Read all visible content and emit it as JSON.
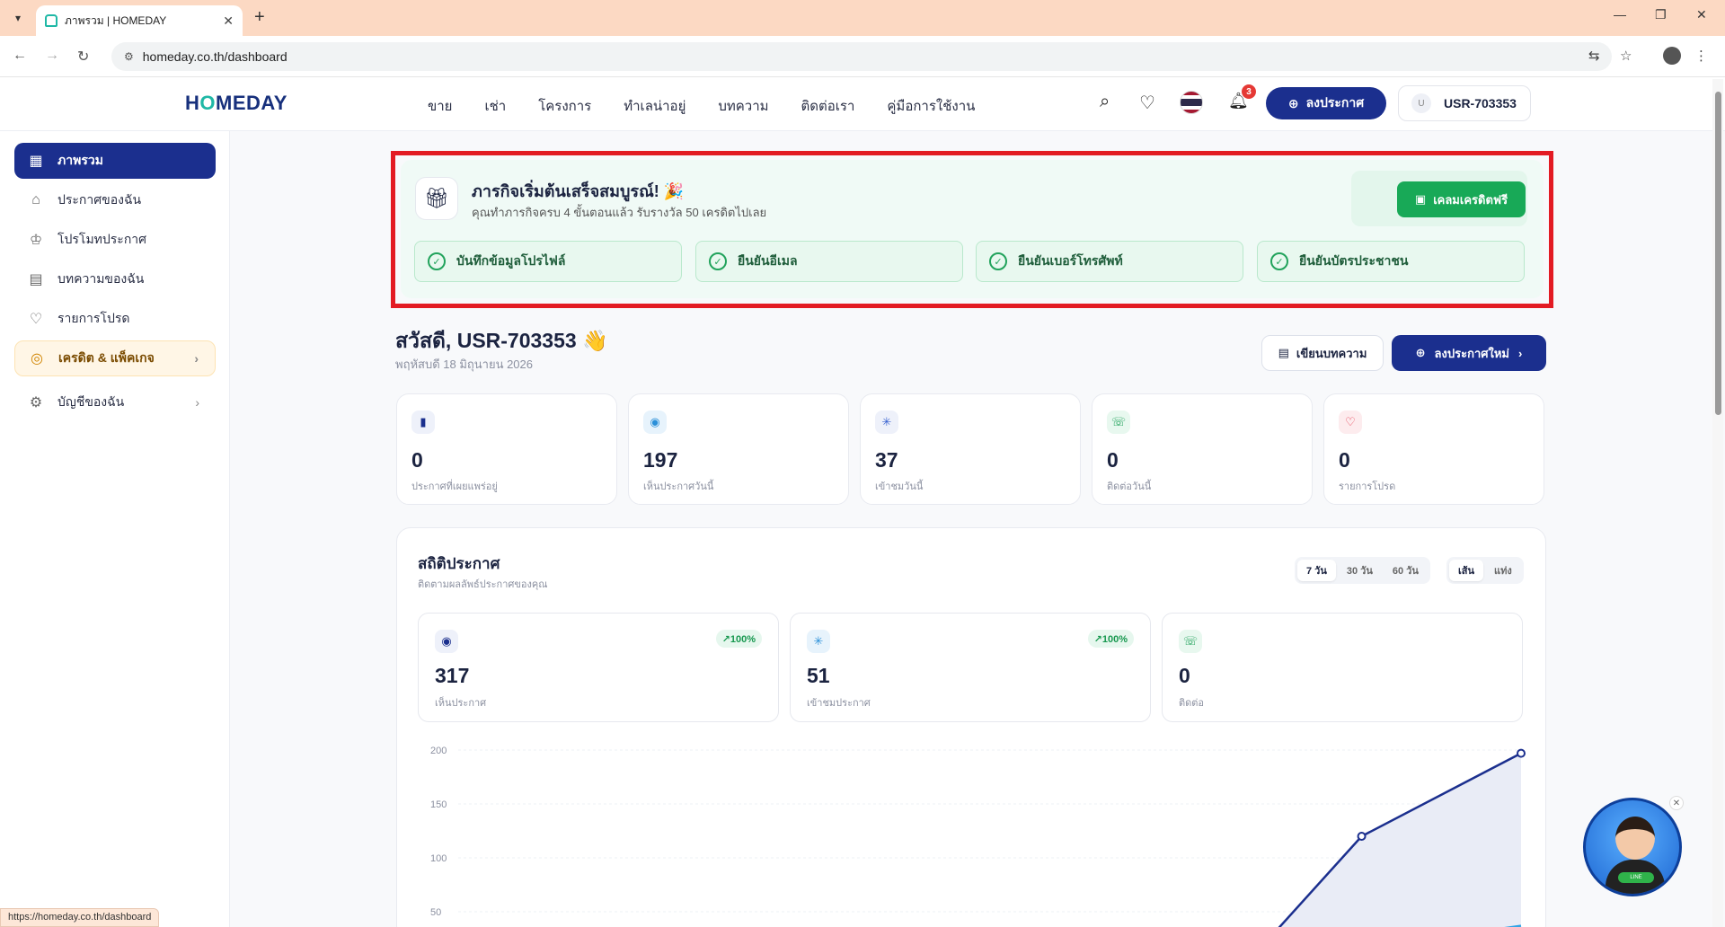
{
  "browser": {
    "tab_title": "ภาพรวม | HOMEDAY",
    "url": "homeday.co.th/dashboard",
    "status_url": "https://homeday.co.th/dashboard"
  },
  "header": {
    "logo_pre": "H",
    "logo_o": "O",
    "logo_post": "MEDAY",
    "nav": [
      "ขาย",
      "เช่า",
      "โครงการ",
      "ทำเลน่าอยู่",
      "บทความ",
      "ติดต่อเรา",
      "คู่มือการใช้งาน"
    ],
    "notification_count": "3",
    "post_button": "ลงประกาศ",
    "user_avatar": "U",
    "user_name": "USR-703353"
  },
  "sidebar": {
    "items": [
      {
        "label": "ภาพรวม",
        "icon": "grid-icon"
      },
      {
        "label": "ประกาศของฉัน",
        "icon": "home-icon"
      },
      {
        "label": "โปรโมทประกาศ",
        "icon": "crown-icon"
      },
      {
        "label": "บทความของฉัน",
        "icon": "document-icon"
      },
      {
        "label": "รายการโปรด",
        "icon": "heart-icon"
      },
      {
        "label": "เครดิต & แพ็คเกจ",
        "icon": "coins-icon"
      },
      {
        "label": "บัญชีของฉัน",
        "icon": "gear-icon"
      }
    ]
  },
  "mission": {
    "title": "ภารกิจเริ่มต้นเสร็จสมบูรณ์! 🎉",
    "subtitle": "คุณทำภารกิจครบ 4 ขั้นตอนแล้ว รับรางวัล 50 เครดิตไปเลย",
    "claim_button": "เคลมเครดิตฟรี",
    "steps": [
      "บันทึกข้อมูลโปรไฟล์",
      "ยืนยันอีเมล",
      "ยืนยันเบอร์โทรศัพท์",
      "ยืนยันบัตรประชาชน"
    ]
  },
  "greeting": {
    "text": "สวัสดี, USR-703353 👋",
    "date": "พฤหัสบดี 18 มิถุนายน 2026",
    "write_button": "เขียนบทความ",
    "new_post_button": "ลงประกาศใหม่"
  },
  "stats": [
    {
      "value": "0",
      "label": "ประกาศที่เผยแพร่อยู่"
    },
    {
      "value": "197",
      "label": "เห็นประกาศวันนี้"
    },
    {
      "value": "37",
      "label": "เข้าชมวันนี้"
    },
    {
      "value": "0",
      "label": "ติดต่อวันนี้"
    },
    {
      "value": "0",
      "label": "รายการโปรด"
    }
  ],
  "analytics": {
    "title": "สถิติประกาศ",
    "subtitle": "ติดตามผลลัพธ์ประกาศของคุณ",
    "ranges": [
      "7 วัน",
      "30 วัน",
      "60 วัน"
    ],
    "chart_types": [
      "เส้น",
      "แท่ง"
    ],
    "kpis": [
      {
        "value": "317",
        "label": "เห็นประกาศ",
        "change": "↗100%"
      },
      {
        "value": "51",
        "label": "เข้าชมประกาศ",
        "change": "↗100%"
      },
      {
        "value": "0",
        "label": "ติดต่อ",
        "change": ""
      }
    ]
  },
  "chart_data": {
    "type": "line",
    "y_ticks": [
      "200",
      "150",
      "100",
      "50"
    ],
    "ylim": [
      0,
      200
    ],
    "series": [
      {
        "color": "#1b2f8e",
        "x_frac": [
          0.74,
          0.85,
          1.0
        ],
        "values": [
          0,
          120,
          197
        ]
      },
      {
        "color": "#33a4e6",
        "x_frac": [
          0.95,
          1.0
        ],
        "values": [
          30,
          37
        ]
      }
    ]
  }
}
